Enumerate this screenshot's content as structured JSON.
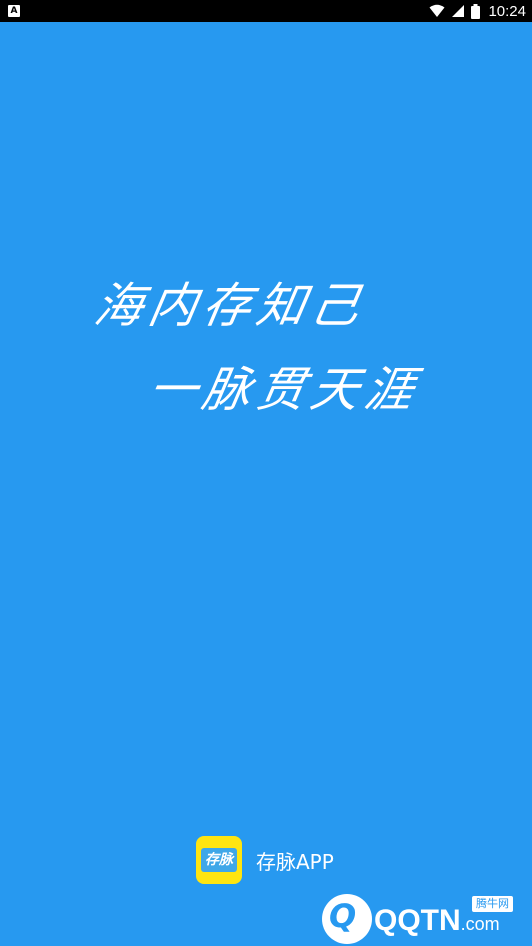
{
  "status_bar": {
    "left_icon": "A",
    "time": "10:24",
    "icons": [
      "wifi-icon",
      "signal-icon",
      "battery-icon"
    ]
  },
  "splash": {
    "slogan_line1": "海内存知己",
    "slogan_line2": "一脉贯天涯",
    "background_color": "#2799F0"
  },
  "brand": {
    "icon_text": "存脉",
    "app_name": "存脉APP",
    "icon_color": "#FFE510"
  },
  "watermark": {
    "mark": "Q",
    "text": "QQTN",
    "suffix": ".com",
    "badge": "腾牛网"
  }
}
